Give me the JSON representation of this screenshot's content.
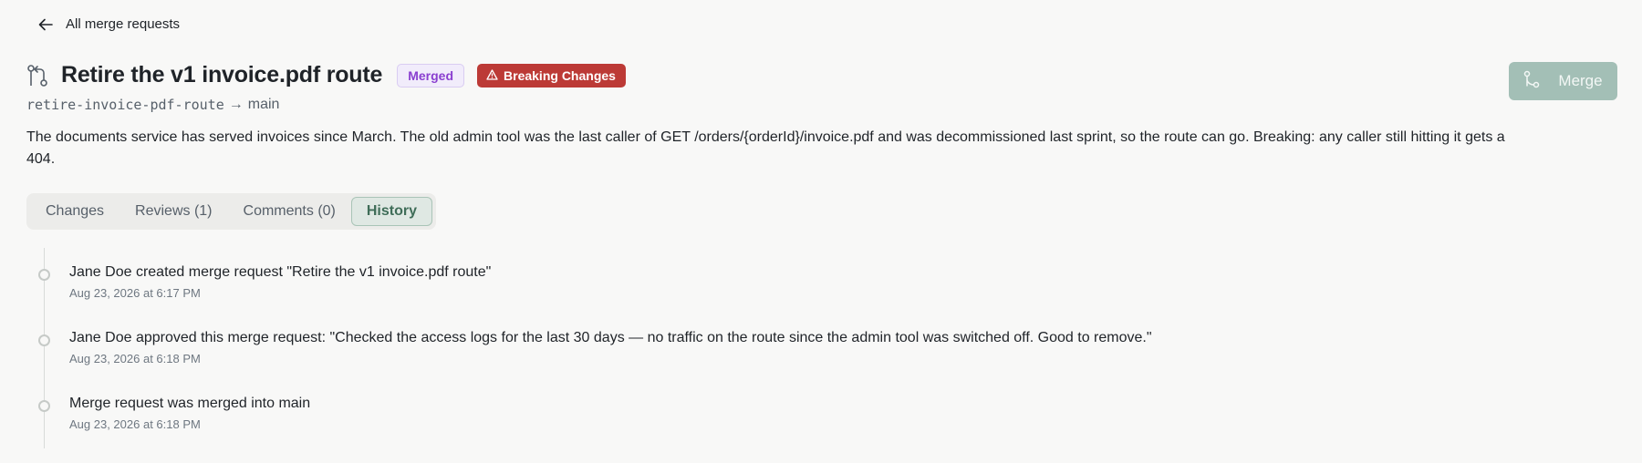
{
  "nav": {
    "back_label": "All merge requests"
  },
  "merge_request": {
    "title": "Retire the v1 invoice.pdf route",
    "status_badge": "Merged",
    "breaking_badge": "Breaking Changes",
    "source_branch": "retire-invoice-pdf-route",
    "arrow": "→",
    "target_branch": "main",
    "description": "The documents service has served invoices since March. The old admin tool was the last caller of GET /orders/{orderId}/invoice.pdf and was decommissioned last sprint, so the route can go. Breaking: any caller still hitting it gets a 404."
  },
  "actions": {
    "merge_label": "Merge"
  },
  "tabs": [
    {
      "label": "Changes",
      "active": false
    },
    {
      "label": "Reviews (1)",
      "active": false
    },
    {
      "label": "Comments (0)",
      "active": false
    },
    {
      "label": "History",
      "active": true
    }
  ],
  "history": [
    {
      "text": "Jane Doe created merge request \"Retire the v1 invoice.pdf route\"",
      "time": "Aug 23, 2026 at 6:17 PM"
    },
    {
      "text": "Jane Doe approved this merge request: \"Checked the access logs for the last 30 days — no traffic on the route since the admin tool was switched off. Good to remove.\"",
      "time": "Aug 23, 2026 at 6:18 PM"
    },
    {
      "text": "Merge request was merged into main",
      "time": "Aug 23, 2026 at 6:18 PM"
    }
  ],
  "colors": {
    "merged_badge_text": "#8a3fd0",
    "breaking_badge_bg": "#bc3a36",
    "merge_button_bg": "#a3bfb6",
    "active_tab_text": "#3f6d58"
  },
  "icons": {
    "back": "arrow-left-icon",
    "merge_request": "merge-request-icon",
    "warning": "warning-triangle-icon",
    "merge_button": "merge-icon"
  }
}
